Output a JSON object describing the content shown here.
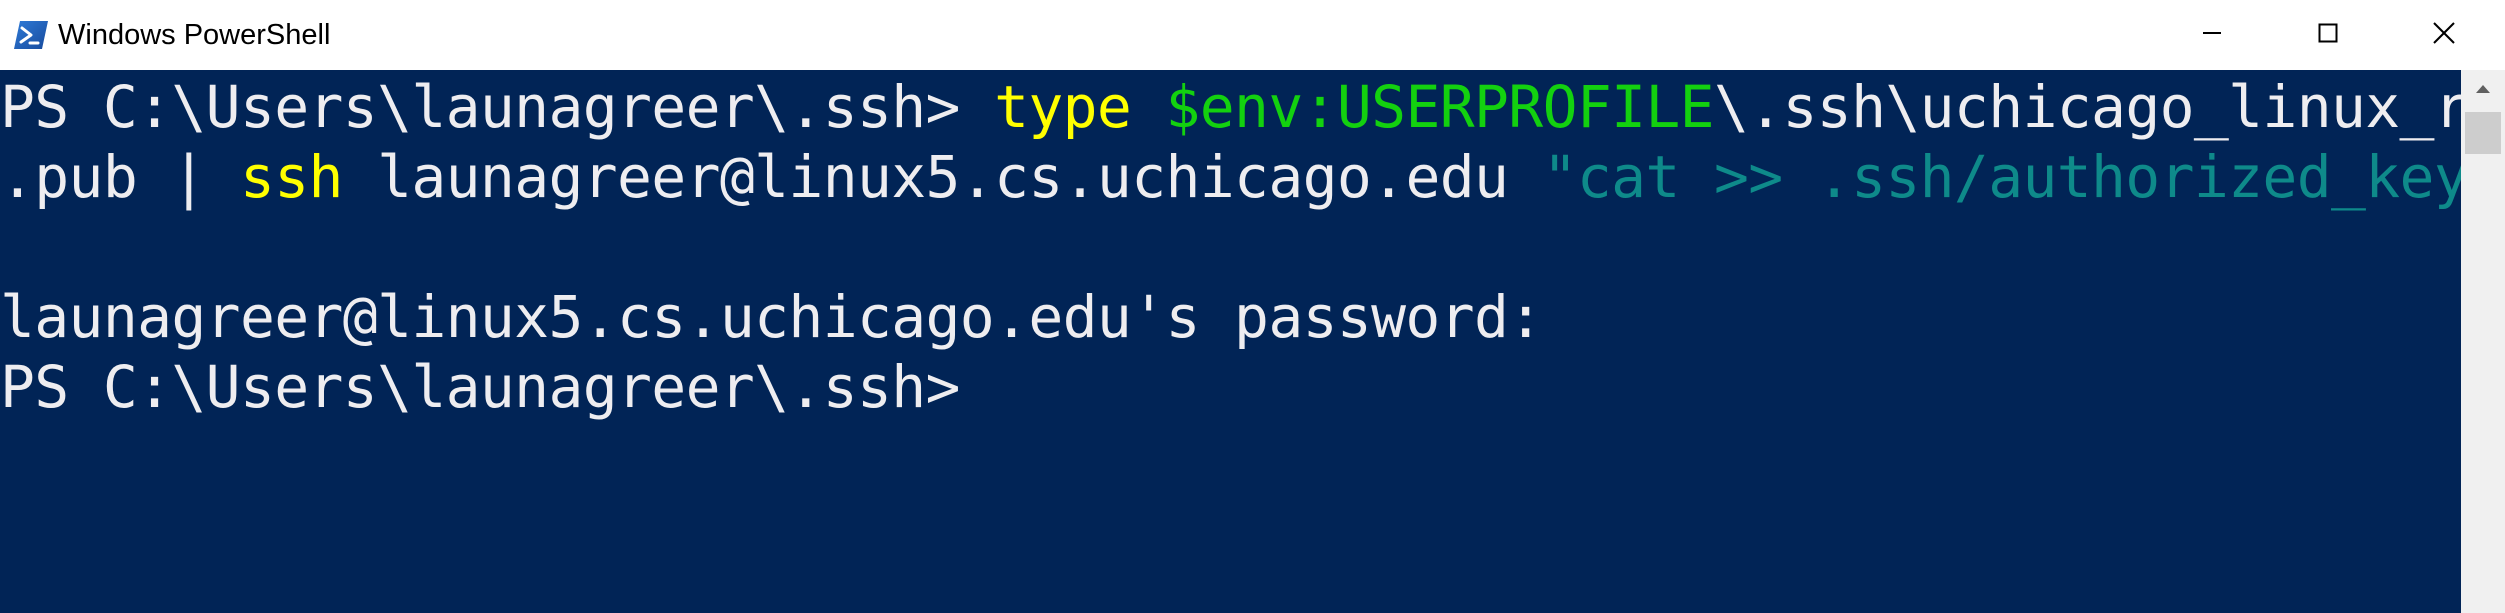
{
  "window": {
    "title": "Windows PowerShell",
    "icons": {
      "app": "powershell-icon",
      "minimize": "minimize-icon",
      "maximize": "maximize-icon",
      "close": "close-icon",
      "scroll_up": "scroll-up-arrow-icon"
    }
  },
  "colors": {
    "console_background": "#012456",
    "default_text": "#eeedf0",
    "command": "#ffff00",
    "variable": "#13d10f",
    "string": "#0e8a8a",
    "scrollbar_track": "#f0f0f0",
    "scrollbar_thumb": "#cdcdcd"
  },
  "console": {
    "line1": {
      "prompt": "PS C:\\Users\\launagreer\\.ssh> ",
      "cmd": "type",
      "sp": " ",
      "var": "$env:USERPROFILE",
      "path": "\\.ssh\\uchicago_linux_rsa"
    },
    "line2": {
      "path_end": ".pub | ",
      "cmd": "ssh",
      "args": " launagreer@linux5.cs.uchicago.edu ",
      "string": "\"cat >> .ssh/authorized_keys\""
    },
    "line3": "launagreer@linux5.cs.uchicago.edu's password:",
    "line4": "PS C:\\Users\\launagreer\\.ssh>"
  }
}
